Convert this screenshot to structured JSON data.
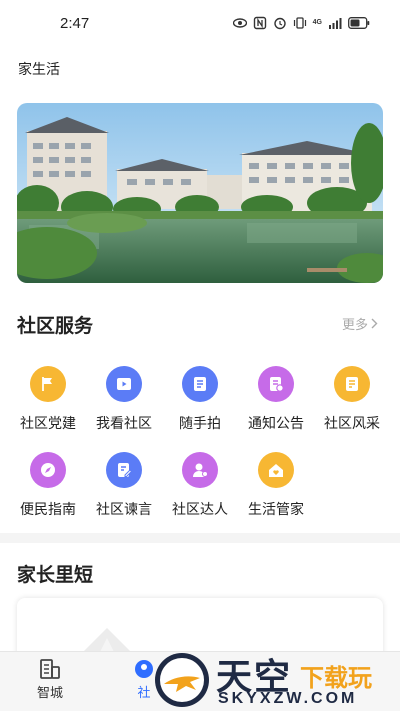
{
  "status_bar": {
    "time": "2:47",
    "icons": [
      "eye-icon",
      "nfc-icon",
      "alarm-icon",
      "vibrate-icon",
      "signal-icon",
      "battery-icon"
    ],
    "network": "4G"
  },
  "app": {
    "title": "家生活"
  },
  "banner": {
    "alt": "community banner"
  },
  "community_services": {
    "title": "社区服务",
    "more_label": "更多",
    "items": [
      {
        "label": "社区党建",
        "icon": "flag-icon",
        "color": "#f7b733"
      },
      {
        "label": "我看社区",
        "icon": "video-icon",
        "color": "#5b7cf6"
      },
      {
        "label": "随手拍",
        "icon": "note-icon",
        "color": "#5b7cf6"
      },
      {
        "label": "通知公告",
        "icon": "notice-icon",
        "color": "#c66be8"
      },
      {
        "label": "社区风采",
        "icon": "doc-icon",
        "color": "#f7b733"
      },
      {
        "label": "便民指南",
        "icon": "compass-icon",
        "color": "#c66be8"
      },
      {
        "label": "社区谏言",
        "icon": "edit-icon",
        "color": "#5b7cf6"
      },
      {
        "label": "社区达人",
        "icon": "person-icon",
        "color": "#c66be8"
      },
      {
        "label": "生活管家",
        "icon": "home-heart-icon",
        "color": "#f7b733"
      }
    ]
  },
  "parents_talk": {
    "title": "家长里短"
  },
  "tabbar": {
    "tabs": [
      {
        "label": "智城",
        "icon": "building-icon",
        "active": false
      },
      {
        "label": "社",
        "icon": "community-icon",
        "active": true
      }
    ]
  },
  "watermark": {
    "main": "天空",
    "sub": "下载玩",
    "url": "SKYXZW.COM"
  }
}
